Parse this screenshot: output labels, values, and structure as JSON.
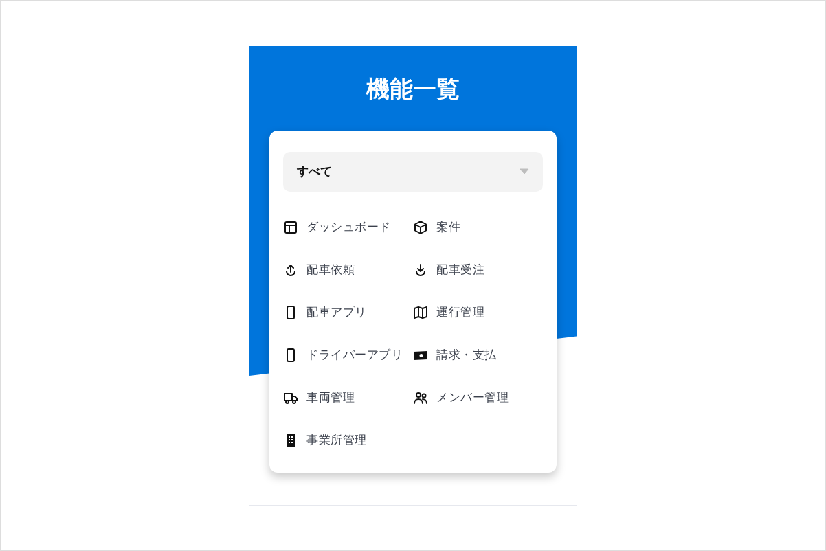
{
  "title": "機能一覧",
  "filter": {
    "value": "すべて"
  },
  "features": [
    {
      "label": "ダッシュボード"
    },
    {
      "label": "案件"
    },
    {
      "label": "配車依頼"
    },
    {
      "label": "配車受注"
    },
    {
      "label": "配車アプリ"
    },
    {
      "label": "運行管理"
    },
    {
      "label": "ドライバーアプリ"
    },
    {
      "label": "請求・支払"
    },
    {
      "label": "車両管理"
    },
    {
      "label": "メンバー管理"
    },
    {
      "label": "事業所管理"
    }
  ]
}
